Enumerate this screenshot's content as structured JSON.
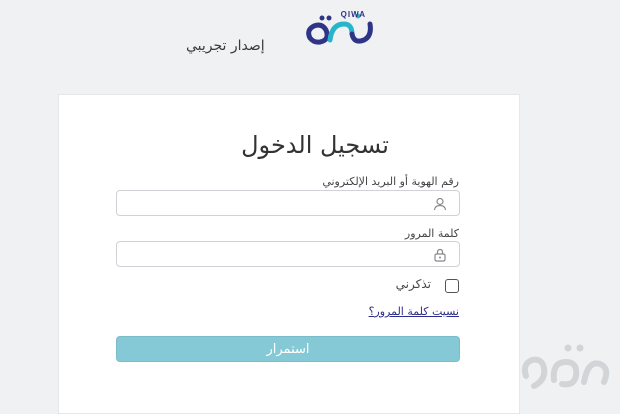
{
  "brand": {
    "logo_latin": "QIWA",
    "logo_arabic": "قوى",
    "tagline": "إصدار تجريبي",
    "colors": {
      "primary": "#2f3586",
      "accent": "#29b5c9"
    }
  },
  "login": {
    "title": "تسجيل الدخول",
    "id_label": "رقم الهوية أو البريد الإلكتروني",
    "id_value": "",
    "id_icon": "user-icon",
    "password_label": "كلمة المرور",
    "password_value": "",
    "password_icon": "lock-icon",
    "remember_label": "تذكرني",
    "remember_checked": false,
    "forgot_link": "نسيت كلمة المرور؟",
    "submit_label": "استمرار",
    "submit_color": "#86c9d6"
  },
  "watermark": {
    "text": "رؤى"
  }
}
